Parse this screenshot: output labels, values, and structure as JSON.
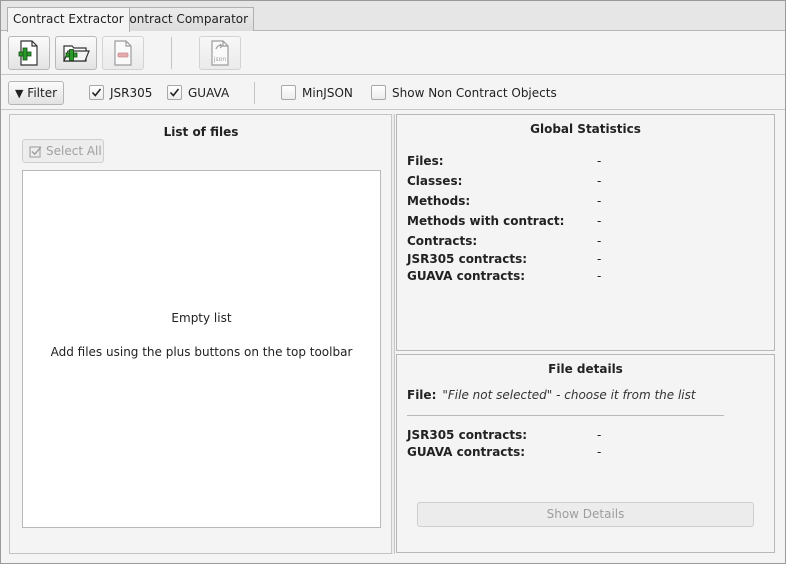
{
  "tabs": [
    {
      "label": "Contract Extractor"
    },
    {
      "label": "Contract Comparator"
    }
  ],
  "toolbar": {
    "icons": [
      "add-file-icon",
      "add-folder-icon",
      "remove-file-icon",
      "export-json-icon"
    ],
    "json_icon_text": "json"
  },
  "filterbar": {
    "filter_label": "Filter",
    "checkboxes": [
      {
        "label": "JSR305",
        "checked": true
      },
      {
        "label": "GUAVA",
        "checked": true
      },
      {
        "label": "MinJSON",
        "checked": false
      },
      {
        "label": "Show Non Contract Objects",
        "checked": false
      }
    ]
  },
  "file_list": {
    "title": "List of files",
    "select_all_label": "Select All",
    "empty_title": "Empty list",
    "empty_hint": "Add files using the plus buttons on the top toolbar"
  },
  "global_stats": {
    "title": "Global Statistics",
    "rows": [
      {
        "label": "Files:",
        "value": "-"
      },
      {
        "label": "Classes:",
        "value": "-"
      },
      {
        "label": "Methods:",
        "value": "-"
      },
      {
        "label": "Methods with contract:",
        "value": "-"
      },
      {
        "label": "Contracts:",
        "value": "-"
      },
      {
        "label": "JSR305 contracts:",
        "value": "-"
      },
      {
        "label": "GUAVA contracts:",
        "value": "-"
      }
    ]
  },
  "file_details": {
    "title": "File details",
    "file_label": "File:",
    "file_value": "\"File not selected\" - choose it from the list",
    "rows": [
      {
        "label": "JSR305 contracts:",
        "value": "-"
      },
      {
        "label": "GUAVA contracts:",
        "value": "-"
      }
    ],
    "show_details_label": "Show Details"
  },
  "colors": {
    "background": "#f4f4f4",
    "accent_green": "#2a9a2a",
    "remove_red": "#e07070"
  }
}
